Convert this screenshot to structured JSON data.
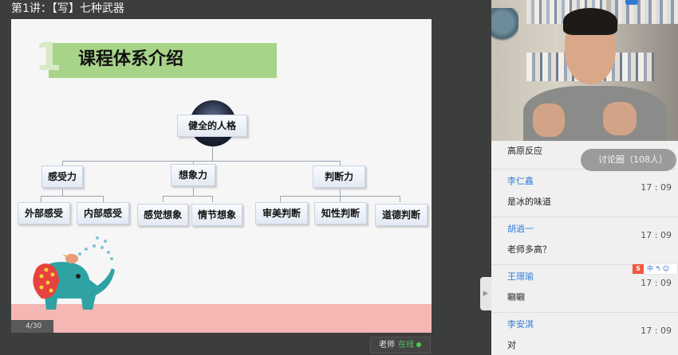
{
  "header": {
    "title": "第1讲：【写】七种武器"
  },
  "slide": {
    "number_mark": "1",
    "title": "课程体系介绍",
    "page": "4/30",
    "mindmap": {
      "root": "健全的人格",
      "branches": [
        {
          "label": "感受力",
          "children": [
            "外部感受",
            "内部感受"
          ]
        },
        {
          "label": "想象力",
          "children": [
            "感觉想象",
            "情节想象"
          ]
        },
        {
          "label": "判断力",
          "children": [
            "审美判断",
            "知性判断",
            "道德判断"
          ]
        }
      ]
    }
  },
  "status": {
    "role": "老师",
    "state": "在线"
  },
  "chat": {
    "discussion_button": "讨论圈（108人）",
    "first_message": "高原反应",
    "messages": [
      {
        "name": "李仁鑫",
        "time": "17 : 09",
        "text": "是冰的味道"
      },
      {
        "name": "胡逍一",
        "time": "17 : 09",
        "text": "老师多高？"
      },
      {
        "name": "王璟瑜",
        "time": "17 : 09",
        "text": "唰唰"
      },
      {
        "name": "李安淇",
        "time": "17 : 09",
        "text": "对"
      }
    ],
    "collapse_icon": "arrow-left-icon",
    "ime": {
      "logo": "S",
      "text": "中 ↰ ☺"
    }
  },
  "colors": {
    "title_green": "#a8d48a",
    "pink_band": "#f5b7b4",
    "name_blue": "#2f7ed8",
    "online_green": "#4cc85b"
  }
}
